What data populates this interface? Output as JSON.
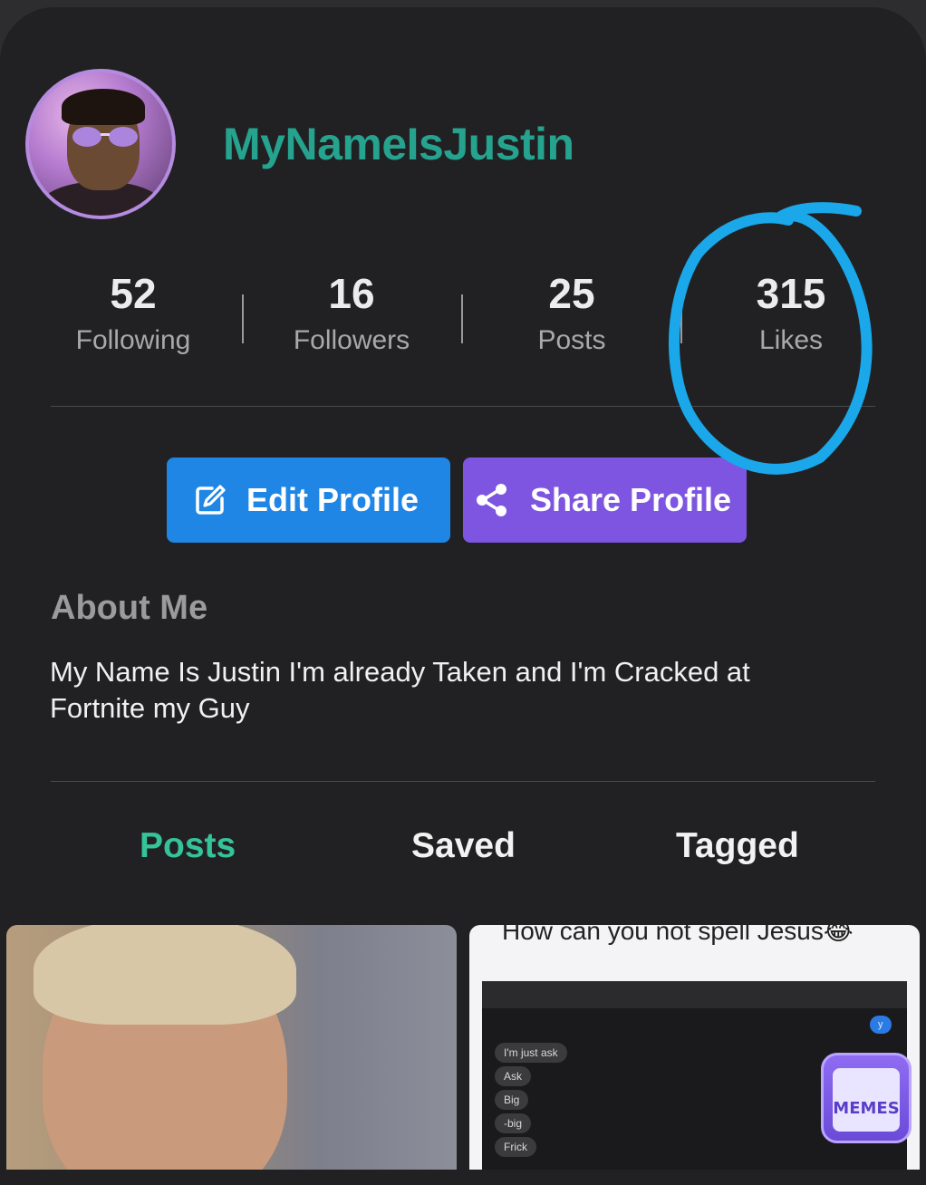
{
  "profile": {
    "username": "MyNameIsJustin"
  },
  "stats": [
    {
      "value": "52",
      "label": "Following"
    },
    {
      "value": "16",
      "label": "Followers"
    },
    {
      "value": "25",
      "label": "Posts"
    },
    {
      "value": "315",
      "label": "Likes"
    }
  ],
  "buttons": {
    "edit": "Edit Profile",
    "share": "Share Profile"
  },
  "about": {
    "title": "About Me",
    "text": "My Name Is Justin I'm already Taken and I'm Cracked at Fortnite my Guy"
  },
  "tabs": [
    "Posts",
    "Saved",
    "Tagged"
  ],
  "posts": {
    "second_caption": "How can you not spell Jesus😂",
    "chat_bubbles": [
      "I'm just ask",
      "Ask",
      "Big",
      "-big",
      "Frick"
    ],
    "reply_bubble": "y"
  },
  "watermark": "MEMES",
  "colors": {
    "username": "#25a38e",
    "active_tab": "#35c39a",
    "edit_button": "#1f86e6",
    "share_button": "#7d55e1",
    "annotation": "#1aa8ea"
  }
}
